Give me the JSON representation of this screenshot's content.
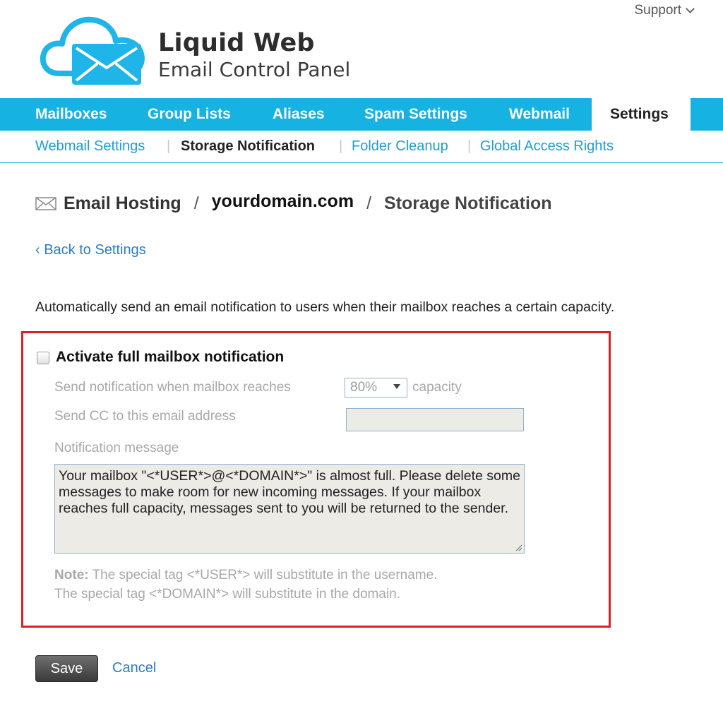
{
  "header": {
    "support_label": "Support",
    "brand_line1": "Liquid Web",
    "brand_line2": "Email Control Panel"
  },
  "topnav": {
    "items": [
      {
        "label": "Mailboxes"
      },
      {
        "label": "Group Lists"
      },
      {
        "label": "Aliases"
      },
      {
        "label": "Spam Settings"
      },
      {
        "label": "Webmail"
      },
      {
        "label": "Settings",
        "active": true
      }
    ],
    "color": "#16b2e2"
  },
  "subnav": {
    "items": [
      {
        "label": "Webmail Settings"
      },
      {
        "label": "Storage Notification",
        "current": true
      },
      {
        "label": "Folder Cleanup"
      },
      {
        "label": "Global Access Rights"
      }
    ],
    "separator": "|"
  },
  "breadcrumb": {
    "root": "Email Hosting",
    "domain": "yourdomain.com",
    "page": "Storage Notification",
    "separator": "/"
  },
  "back_link": "‹ Back to Settings",
  "intro_text": "Automatically send an email notification to users when their mailbox reaches a certain capacity.",
  "form": {
    "activate_label": "Activate full mailbox notification",
    "activate_checked": false,
    "threshold_label": "Send notification when mailbox reaches",
    "threshold_value": "80%",
    "threshold_suffix": "capacity",
    "cc_label": "Send CC to this email address",
    "cc_value": "",
    "message_label": "Notification message",
    "message_value": "Your mailbox \"<*USER*>@<*DOMAIN*>\" is almost full. Please delete some messages to make room for new incoming messages. If your mailbox reaches full capacity, messages sent to you will be returned to the sender.",
    "note_prefix": "Note:",
    "note_line1": "The special tag <*USER*> will substitute in the username.",
    "note_line2": "The special tag <*DOMAIN*> will substitute in the domain."
  },
  "actions": {
    "save_label": "Save",
    "cancel_label": "Cancel"
  },
  "colors": {
    "accent": "#16b2e2",
    "link": "#2b7cc8",
    "highlight_border": "#e11d25"
  }
}
